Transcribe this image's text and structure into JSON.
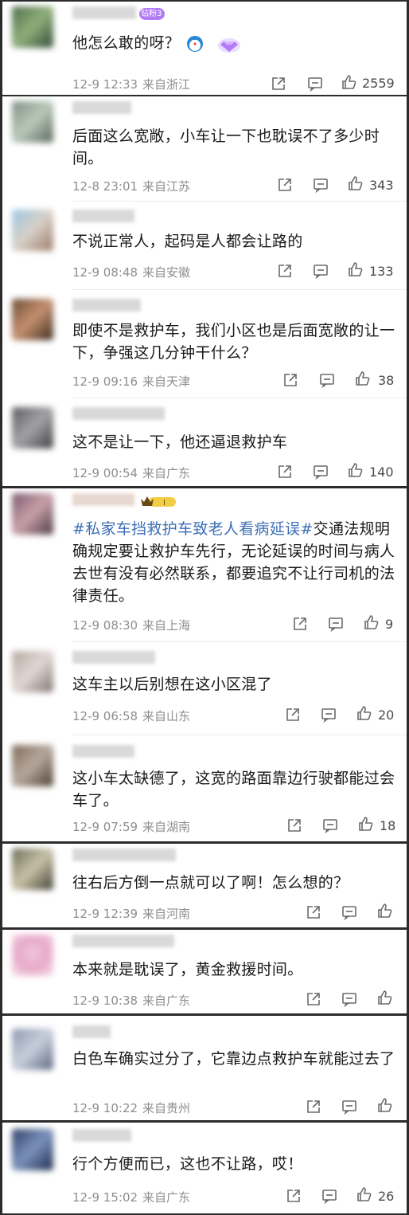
{
  "comments": [
    {
      "fan_badge": "钻粉3",
      "text": "他怎么敢的呀？",
      "time": "12-9 12:33",
      "location": "来自浙江",
      "likes": "2559"
    },
    {
      "text": "后面这么宽敞，小车让一下也耽误不了多少时间。",
      "time": "12-8 23:01",
      "location": "来自江苏",
      "likes": "343"
    },
    {
      "text": "不说正常人，起码是人都会让路的",
      "time": "12-9 08:48",
      "location": "来自安徽",
      "likes": "133"
    },
    {
      "text": "即使不是救护车，我们小区也是后面宽敞的让一下，争强这几分钟干什么？",
      "time": "12-9 09:16",
      "location": "来自天津",
      "likes": "38"
    },
    {
      "text": "这不是让一下，他还逼退救护车",
      "time": "12-9 00:54",
      "location": "来自广东",
      "likes": "140"
    },
    {
      "level_badge": "I",
      "hashtag": "#私家车挡救护车致老人看病延误#",
      "text": "交通法规明确规定要让救护车先行，无论延误的时间与病人去世有没有必然联系，都要追究不让行司机的法律责任。",
      "time": "12-9 08:30",
      "location": "来自上海",
      "likes": "9"
    },
    {
      "text": "这车主以后别想在这小区混了",
      "time": "12-9 06:58",
      "location": "来自山东",
      "likes": "20"
    },
    {
      "text": "这小车太缺德了，这宽的路面靠边行驶都能过会车了。",
      "time": "12-9 07:59",
      "location": "来自湖南",
      "likes": "18"
    },
    {
      "text": "往右后方倒一点就可以了啊！怎么想的？",
      "time": "12-9 12:39",
      "location": "来自河南",
      "likes": ""
    },
    {
      "text": "本来就是耽误了，黄金救援时间。",
      "time": "12-9 10:38",
      "location": "来自广东",
      "likes": ""
    },
    {
      "text": "白色车确实过分了，它靠边点救护车就能过去了",
      "time": "12-9 10:22",
      "location": "来自贵州",
      "likes": ""
    },
    {
      "text": "行个方便而已，这也不让路，哎！",
      "time": "12-9 15:02",
      "location": "来自广东",
      "likes": "26"
    }
  ],
  "icons": {
    "share": "share-icon",
    "reply": "comment-icon",
    "like": "thumbs-up-icon"
  },
  "colors": {
    "hashtag": "#3d6fb6",
    "fan_badge": "#b27cf5",
    "meta": "#8e8e8e",
    "background": "#2b2b2b"
  }
}
